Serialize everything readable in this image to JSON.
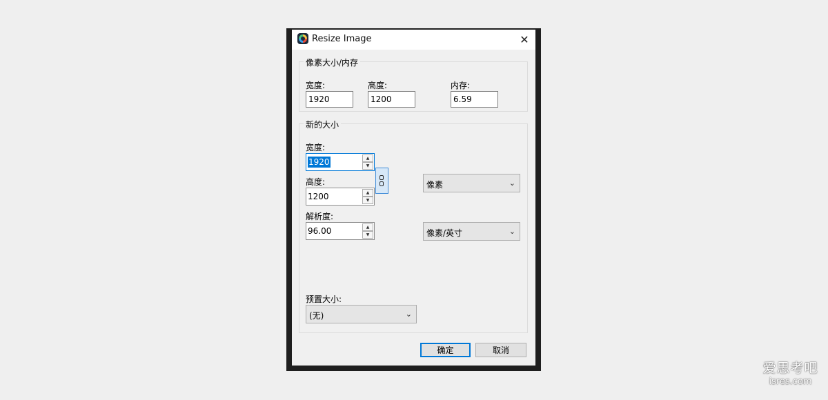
{
  "window": {
    "title": "Resize Image"
  },
  "pixel_group": {
    "legend": "像素大小/内存",
    "width_label": "宽度:",
    "width_value": "1920",
    "height_label": "高度:",
    "height_value": "1200",
    "memory_label": "内存:",
    "memory_value": "6.59"
  },
  "new_size_group": {
    "legend": "新的大小",
    "width_label": "宽度:",
    "width_value": "1920",
    "height_label": "高度:",
    "height_value": "1200",
    "resolution_label": "解析度:",
    "resolution_value": "96.00",
    "unit_select": "像素",
    "resolution_unit_select": "像素/英寸",
    "preset_label": "预置大小:",
    "preset_select": "(无)"
  },
  "buttons": {
    "ok": "确定",
    "cancel": "取消"
  },
  "watermark": {
    "line1": "爱思考吧",
    "line2": "isres.com"
  },
  "icons": {
    "close": "close-icon",
    "app": "app-icon",
    "spin_up": "chevron-up-icon",
    "spin_down": "chevron-down-icon",
    "link": "chain-link-icon",
    "dropdown": "chevron-down-icon"
  }
}
